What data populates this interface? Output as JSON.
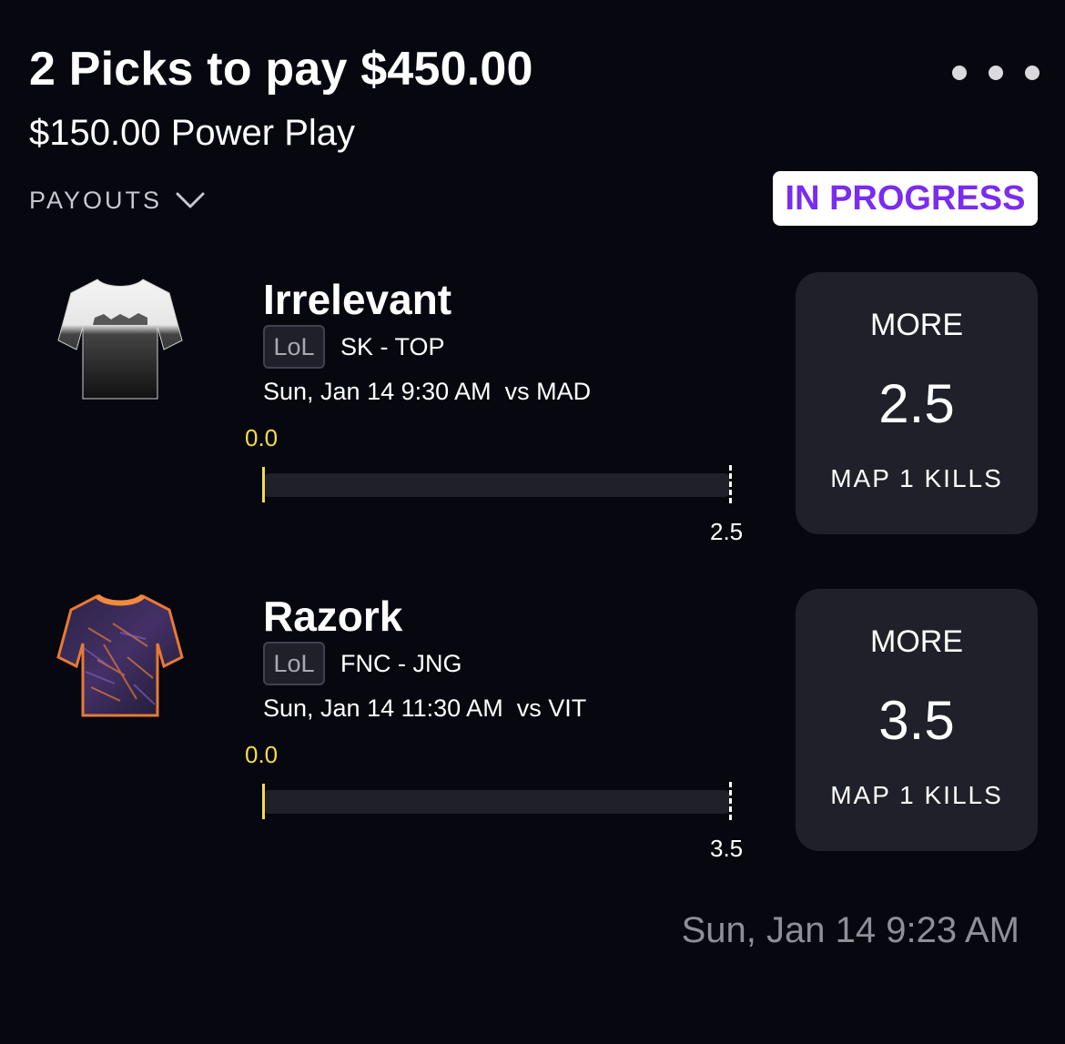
{
  "header": {
    "title": "2 Picks to pay $450.00",
    "subtitle": "$150.00 Power Play",
    "more_icon": "ellipsis-icon",
    "payouts_label": "PAYOUTS",
    "payouts_icon": "chevron-down-icon",
    "status": "IN PROGRESS"
  },
  "picks": [
    {
      "player": "Irrelevant",
      "league": "LoL",
      "team_position": "SK - TOP",
      "game_info": "Sun, Jan 14 9:30 AM  vs MAD",
      "current_value": "0.0",
      "target_value": "2.5",
      "progress_fraction": 0,
      "choice": "MORE",
      "line": "2.5",
      "stat": "MAP 1 KILLS",
      "jersey_icon": "white-black-jersey-icon"
    },
    {
      "player": "Razork",
      "league": "LoL",
      "team_position": "FNC - JNG",
      "game_info": "Sun, Jan 14 11:30 AM  vs VIT",
      "current_value": "0.0",
      "target_value": "3.5",
      "progress_fraction": 0,
      "choice": "MORE",
      "line": "3.5",
      "stat": "MAP 1 KILLS",
      "jersey_icon": "purple-orange-jersey-icon"
    }
  ],
  "footer": {
    "timestamp": "Sun, Jan 14 9:23 AM"
  },
  "colors": {
    "background": "#06070f",
    "card": "#1f2029",
    "status_text": "#7a2cf0",
    "progress_marker": "#f2dc4c",
    "muted_text": "#8e8f97"
  }
}
